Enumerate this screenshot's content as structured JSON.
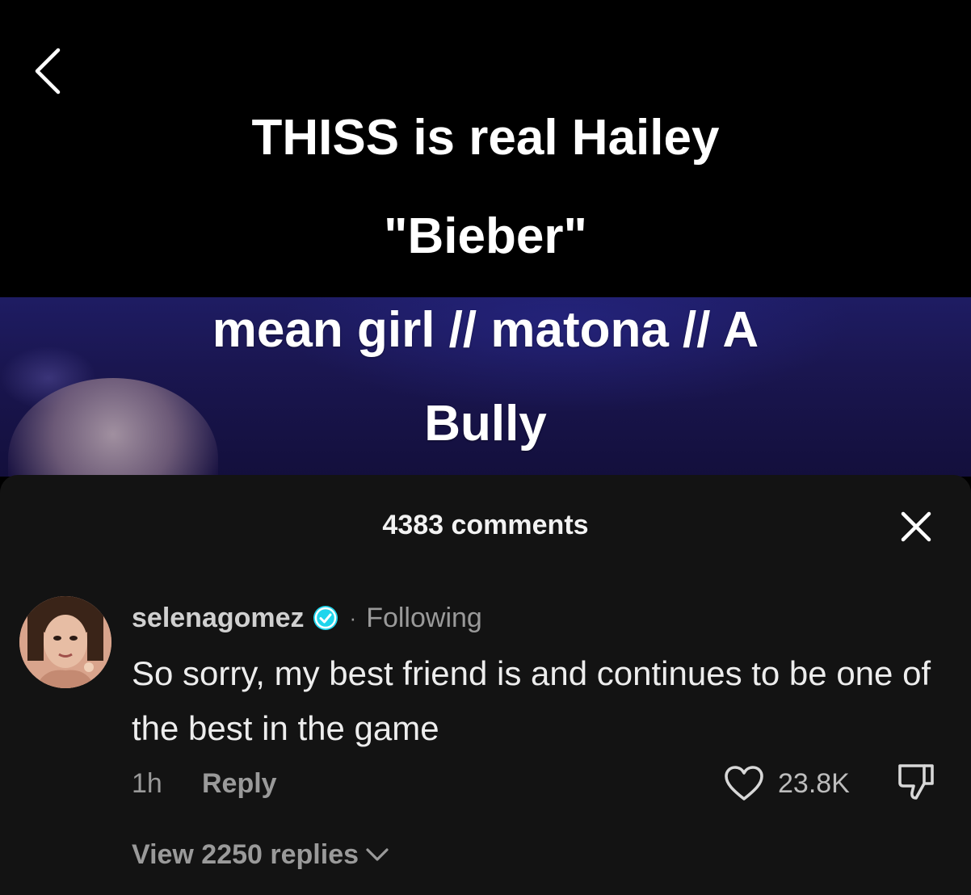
{
  "video": {
    "overlay_lines": [
      "THISS is real Hailey",
      "\"Bieber\"",
      "mean girl // matona // A",
      "Bully"
    ]
  },
  "icons": {
    "back": "chevron-left-icon",
    "close": "close-icon",
    "verified": "verified-badge-icon",
    "like": "heart-icon",
    "dislike": "thumbs-down-icon",
    "expand": "chevron-down-icon"
  },
  "colors": {
    "sheet_background": "#131313",
    "verified_blue": "#20d5ec",
    "secondary_text": "#9a9a9a"
  },
  "comments_sheet": {
    "title": "4383 comments"
  },
  "comment": {
    "username": "selenagomez",
    "separator": "·",
    "following_label": "Following",
    "text": "So sorry, my best friend is and continues to be one of the best in the game",
    "time": "1h",
    "reply_label": "Reply",
    "likes": "23.8K",
    "view_replies": "View 2250 replies"
  }
}
